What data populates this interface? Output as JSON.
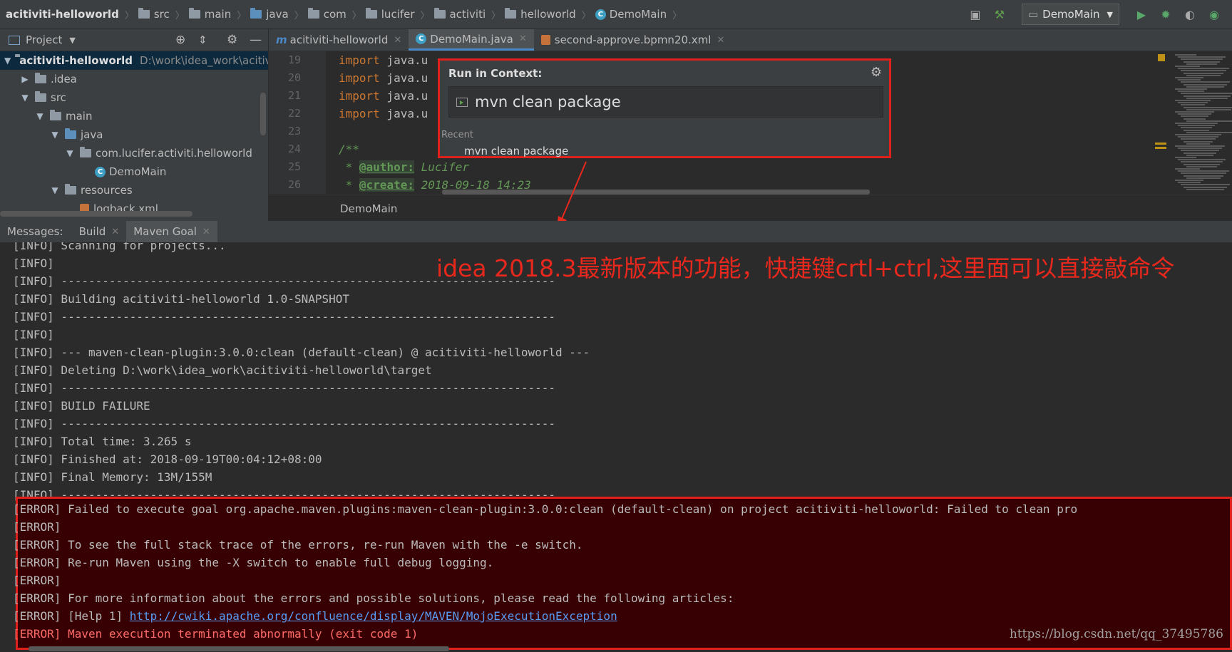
{
  "navbar": {
    "crumbs": [
      {
        "label": "acitiviti-helloworld",
        "icon": "module-folder"
      },
      {
        "label": "src",
        "icon": "folder"
      },
      {
        "label": "main",
        "icon": "folder"
      },
      {
        "label": "java",
        "icon": "source-folder"
      },
      {
        "label": "com",
        "icon": "package"
      },
      {
        "label": "lucifer",
        "icon": "package"
      },
      {
        "label": "activiti",
        "icon": "package"
      },
      {
        "label": "helloworld",
        "icon": "package"
      },
      {
        "label": "DemoMain",
        "icon": "class-c"
      }
    ],
    "run_config": "DemoMain"
  },
  "project_panel": {
    "title": "Project",
    "tree": [
      {
        "label": "acitiviti-helloworld",
        "path": "D:\\work\\idea_work\\acitiv",
        "depth": 0,
        "expanded": true,
        "bold": true
      },
      {
        "label": ".idea",
        "depth": 1,
        "expanded": false
      },
      {
        "label": "src",
        "depth": 1,
        "expanded": true
      },
      {
        "label": "main",
        "depth": 2,
        "expanded": true
      },
      {
        "label": "java",
        "depth": 3,
        "expanded": true
      },
      {
        "label": "com.lucifer.activiti.helloworld",
        "depth": 4,
        "expanded": true
      },
      {
        "label": "DemoMain",
        "depth": 5,
        "leaf": true
      },
      {
        "label": "resources",
        "depth": 3,
        "expanded": true
      },
      {
        "label": "logback.xml",
        "depth": 4,
        "leaf": true
      }
    ]
  },
  "editor": {
    "tabs": [
      {
        "label": "acitiviti-helloworld",
        "icon": "maven-m"
      },
      {
        "label": "DemoMain.java",
        "icon": "class-c",
        "active": true
      },
      {
        "label": "second-approve.bpmn20.xml",
        "icon": "xml"
      }
    ],
    "line_numbers": [
      "19",
      "20",
      "21",
      "22",
      "23",
      "24",
      "25",
      "26"
    ],
    "lines": [
      {
        "kw": "import",
        "rest": " java.u"
      },
      {
        "kw": "import",
        "rest": " java.u"
      },
      {
        "kw": "import",
        "rest": " java.u"
      },
      {
        "kw": "import",
        "rest": " java.u"
      },
      {
        "kw": "",
        "rest": ""
      },
      {
        "comment": "/**"
      },
      {
        "prefix": " * ",
        "tag": "@author:",
        "value": " Lucifer"
      },
      {
        "prefix": " * ",
        "tag": "@create:",
        "value": " 2018-09-18 14:23"
      }
    ],
    "status_label": "DemoMain"
  },
  "run_popup": {
    "title": "Run in Context:",
    "input_value": "mvn clean package",
    "recent_label": "Recent",
    "recent_items": [
      "mvn clean package"
    ]
  },
  "messages": {
    "label": "Messages:",
    "tabs": [
      "Build",
      "Maven Goal"
    ]
  },
  "console_lines": [
    "[INFO] Scanning for projects...",
    "[INFO]",
    "[INFO] ------------------------------------------------------------------------",
    "[INFO] Building acitiviti-helloworld 1.0-SNAPSHOT",
    "[INFO] ------------------------------------------------------------------------",
    "[INFO]",
    "[INFO] --- maven-clean-plugin:3.0.0:clean (default-clean) @ acitiviti-helloworld ---",
    "[INFO] Deleting D:\\work\\idea_work\\acitiviti-helloworld\\target",
    "[INFO] ------------------------------------------------------------------------",
    "[INFO] BUILD FAILURE",
    "[INFO] ------------------------------------------------------------------------",
    "[INFO] Total time: 3.265 s",
    "[INFO] Finished at: 2018-09-19T00:04:12+08:00",
    "[INFO] Final Memory: 13M/155M",
    "[INFO] ------------------------------------------------------------------------"
  ],
  "error_lines": [
    "[ERROR] Failed to execute goal org.apache.maven.plugins:maven-clean-plugin:3.0.0:clean (default-clean) on project acitiviti-helloworld: Failed to clean pro",
    "[ERROR]",
    "[ERROR] To see the full stack trace of the errors, re-run Maven with the -e switch.",
    "[ERROR] Re-run Maven using the -X switch to enable full debug logging.",
    "[ERROR]",
    "[ERROR] For more information about the errors and possible solutions, please read the following articles:"
  ],
  "error_help_prefix": "[ERROR] [Help 1] ",
  "error_help_link": "http://cwiki.apache.org/confluence/display/MAVEN/MojoExecutionException",
  "error_final": "[ERROR] Maven execution terminated abnormally (exit code 1)",
  "annotation": "idea 2018.3最新版本的功能，快捷键crtl+ctrl,这里面可以直接敲命令",
  "watermark": "https://blog.csdn.net/qq_37495786",
  "colors": {
    "annotation_red": "#e8281d",
    "error_bg": "#370003",
    "keyword": "#cc7832",
    "doc_comment": "#629755"
  }
}
